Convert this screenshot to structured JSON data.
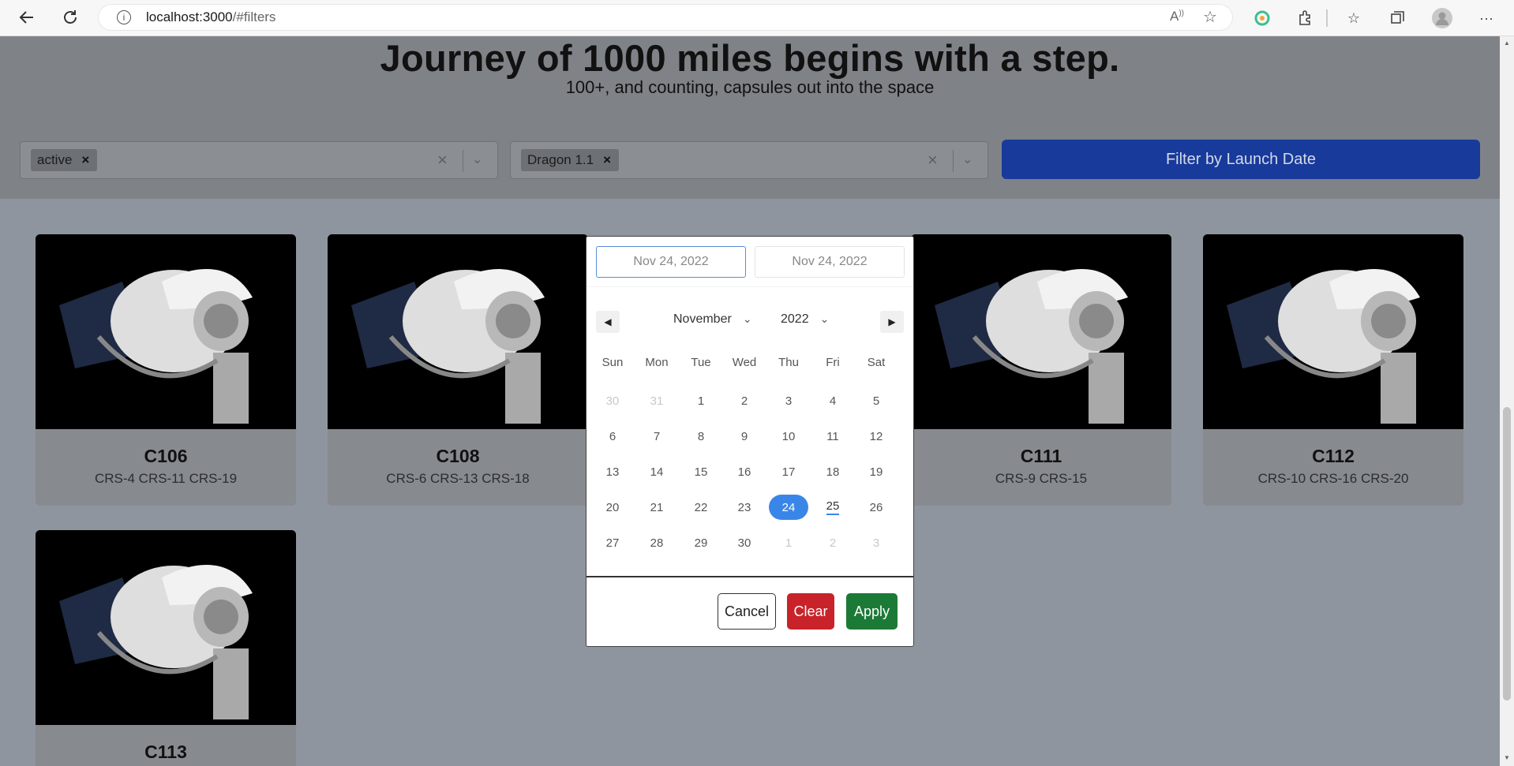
{
  "browser": {
    "url_host": "localhost:3000",
    "url_path": "/#filters"
  },
  "hero": {
    "title": "Journey of 1000 miles begins with a step.",
    "subtitle": "100+, and counting, capsules out into the space"
  },
  "filters": {
    "status_chip": "active",
    "type_chip": "Dragon 1.1",
    "date_button": "Filter by Launch Date"
  },
  "cards": [
    {
      "name": "C106",
      "missions": "CRS-4 CRS-11 CRS-19"
    },
    {
      "name": "C108",
      "missions": "CRS-6 CRS-13 CRS-18"
    },
    {
      "name": "C111",
      "missions": "CRS-9 CRS-15"
    },
    {
      "name": "C112",
      "missions": "CRS-10 CRS-16 CRS-20"
    },
    {
      "name": "C113",
      "missions": ""
    }
  ],
  "datepicker": {
    "start": "Nov 24, 2022",
    "end": "Nov 24, 2022",
    "month": "November",
    "year": "2022",
    "weekdays": [
      "Sun",
      "Mon",
      "Tue",
      "Wed",
      "Thu",
      "Fri",
      "Sat"
    ],
    "weeks": [
      [
        "30",
        "31",
        "1",
        "2",
        "3",
        "4",
        "5"
      ],
      [
        "6",
        "7",
        "8",
        "9",
        "10",
        "11",
        "12"
      ],
      [
        "13",
        "14",
        "15",
        "16",
        "17",
        "18",
        "19"
      ],
      [
        "20",
        "21",
        "22",
        "23",
        "24",
        "25",
        "26"
      ],
      [
        "27",
        "28",
        "29",
        "30",
        "1",
        "2",
        "3"
      ]
    ],
    "selected_day": "24",
    "today_day": "25",
    "cancel": "Cancel",
    "clear": "Clear",
    "apply": "Apply"
  },
  "colors": {
    "primary_button": "#173a9b",
    "selected_day": "#3a86e8",
    "clear_button": "#c8232a",
    "apply_button": "#1b7a36"
  }
}
